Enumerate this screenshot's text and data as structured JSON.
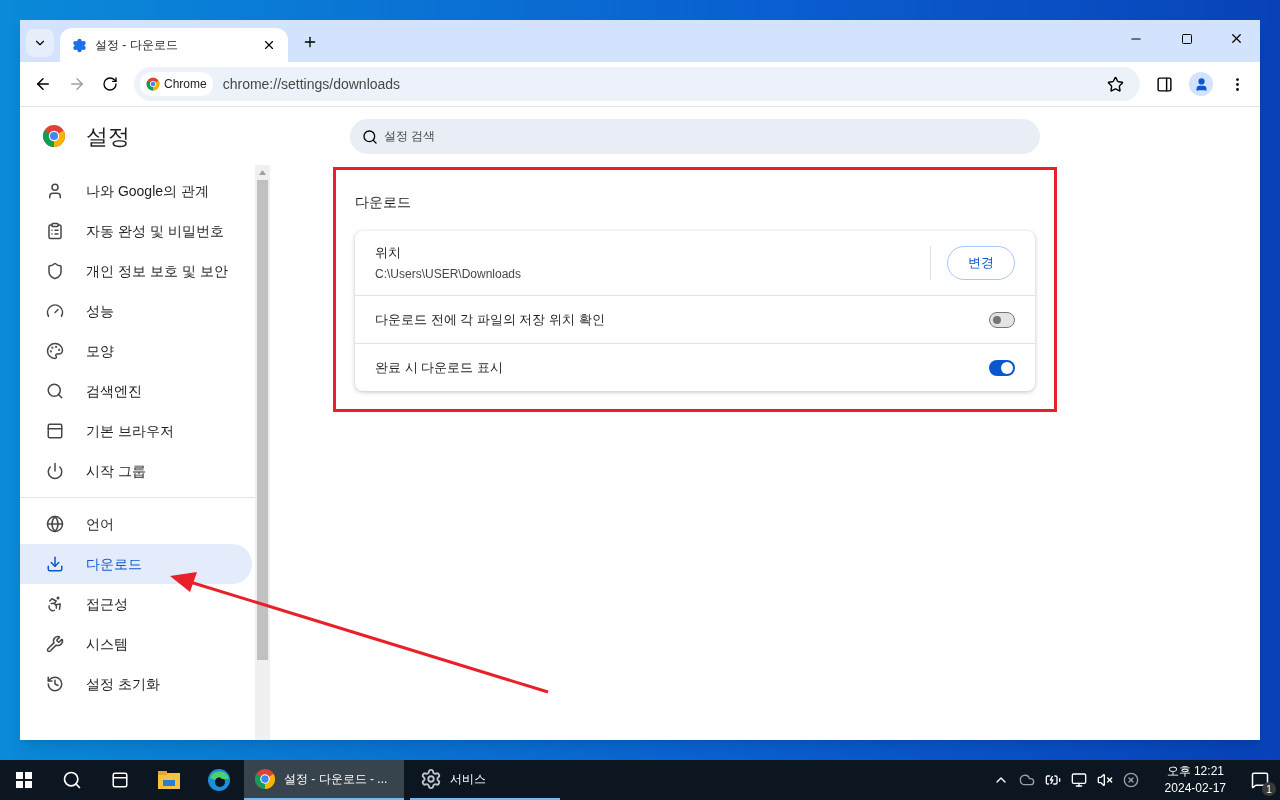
{
  "browser": {
    "tab": {
      "title": "설정 - 다운로드",
      "selected": true
    },
    "url_chip": "Chrome",
    "url": "chrome://settings/downloads"
  },
  "settings": {
    "title": "설정",
    "search": {
      "placeholder": "설정 검색"
    },
    "nav_groups": [
      [
        {
          "label": "나와 Google의 관계",
          "kind": "person",
          "selected": false
        },
        {
          "label": "자동 완성 및 비밀번호",
          "kind": "clipboard",
          "selected": false
        },
        {
          "label": "개인 정보 보호 및 보안",
          "kind": "shield",
          "selected": false
        },
        {
          "label": "성능",
          "kind": "gauge",
          "selected": false
        },
        {
          "label": "모양",
          "kind": "palette",
          "selected": false
        },
        {
          "label": "검색엔진",
          "kind": "search",
          "selected": false
        },
        {
          "label": "기본 브라우저",
          "kind": "browser",
          "selected": false
        },
        {
          "label": "시작 그룹",
          "kind": "power",
          "selected": false
        }
      ],
      [
        {
          "label": "언어",
          "kind": "globe",
          "selected": false
        },
        {
          "label": "다운로드",
          "kind": "download",
          "selected": true
        },
        {
          "label": "접근성",
          "kind": "accessibility",
          "selected": false
        },
        {
          "label": "시스템",
          "kind": "wrench",
          "selected": false
        },
        {
          "label": "설정 초기화",
          "kind": "history",
          "selected": false
        }
      ]
    ],
    "section": {
      "title": "다운로드",
      "rows": [
        {
          "kind": "location",
          "label": "위치",
          "value": "C:\\Users\\USER\\Downloads",
          "button": "변경"
        },
        {
          "kind": "toggle",
          "label": "다운로드 전에 각 파일의 저장 위치 확인",
          "on": false
        },
        {
          "kind": "toggle",
          "label": "완료 시 다운로드 표시",
          "on": true
        }
      ]
    }
  },
  "taskbar": {
    "apps": [
      {
        "kind": "chrome",
        "label": "설정 - 다운로드 - ...",
        "selected": true
      },
      {
        "kind": "services",
        "label": "서비스",
        "selected": false
      }
    ],
    "clock": {
      "time": "오후 12:21",
      "date": "2024-02-17"
    },
    "notifications": "1"
  }
}
